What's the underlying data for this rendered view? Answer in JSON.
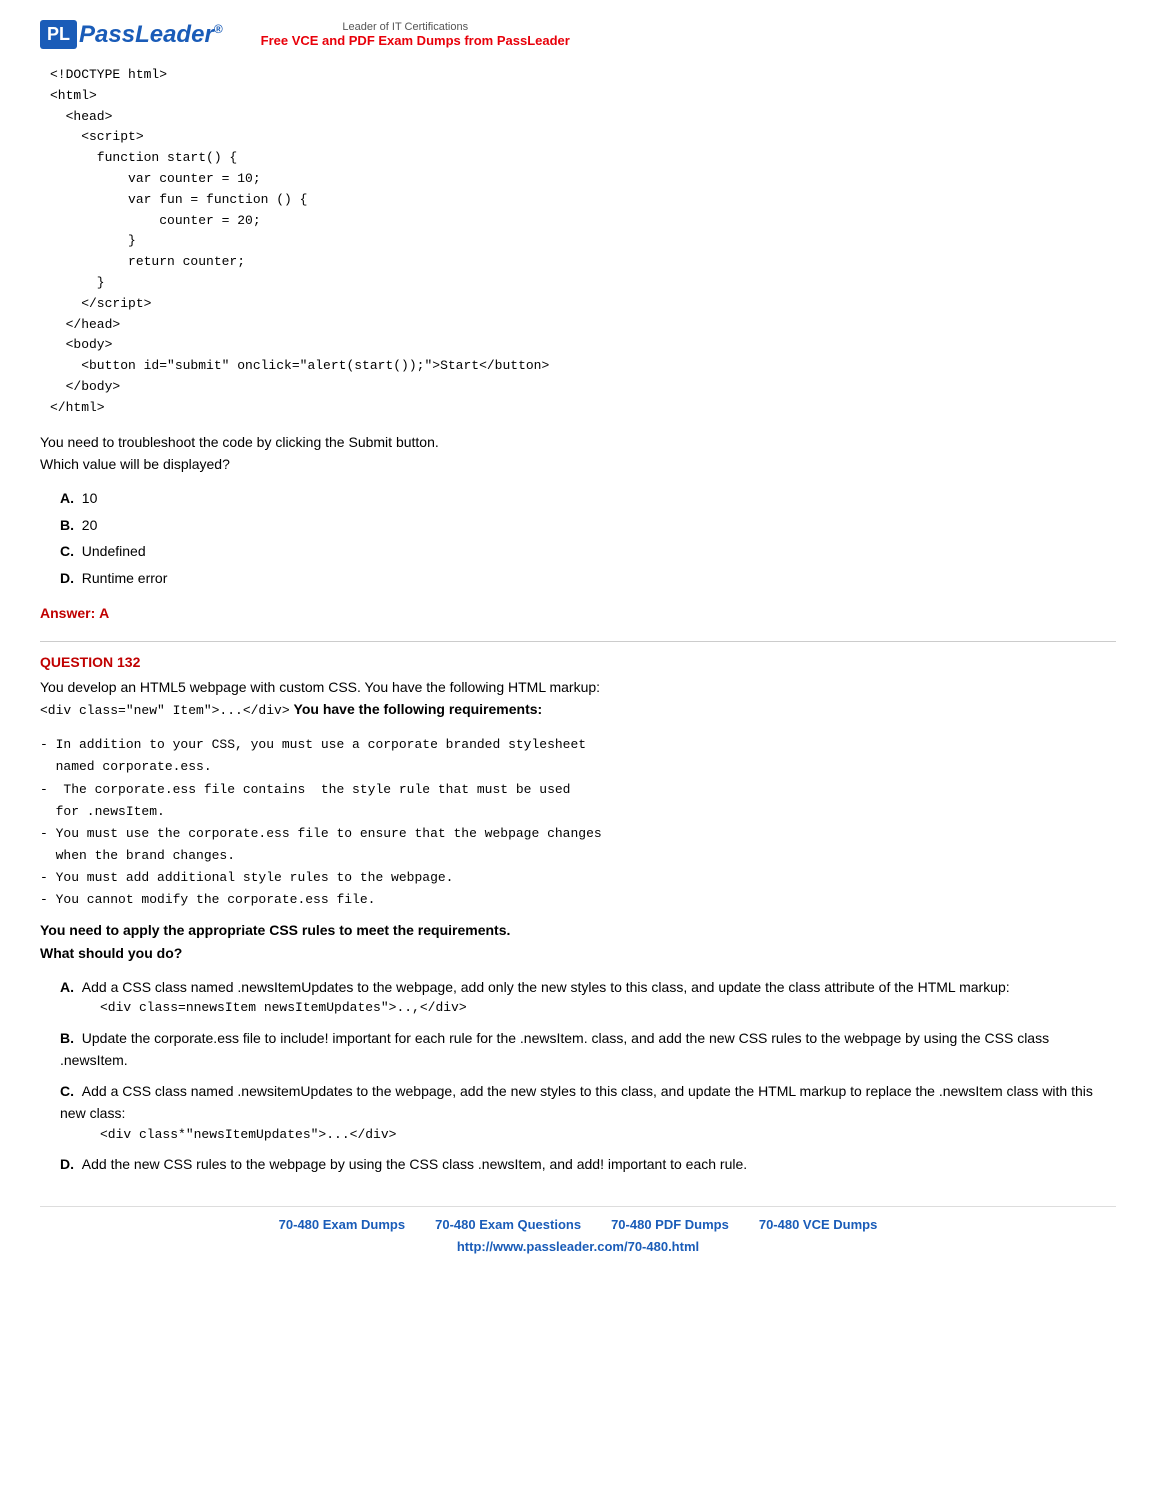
{
  "header": {
    "logo_pl": "PL",
    "logo_name": "Pass",
    "logo_name_italic": "Leader",
    "logo_reg": "®",
    "leader_subtitle": "Leader of IT Certifications",
    "free_vce": "Free VCE and PDF Exam Dumps from PassLeader"
  },
  "code_block": {
    "lines": [
      "<!DOCTYPE html>",
      "<html>",
      "  <head>",
      "    <script>",
      "      function start() {",
      "          var counter = 10;",
      "          var fun = function () {",
      "              counter = 20;",
      "          }",
      "          return counter;",
      "      }",
      "    </script>",
      "  </head>",
      "  <body>",
      "    <button id=\"submit\" onclick=\"alert(start());\">Start</button>",
      "  </body>",
      "</html>"
    ]
  },
  "question_131": {
    "instruction_1": "You need to troubleshoot the code by clicking the Submit button.",
    "instruction_2": "Which value will be displayed?",
    "options": [
      {
        "label": "A.",
        "text": "10"
      },
      {
        "label": "B.",
        "text": "20"
      },
      {
        "label": "C.",
        "text": "Undefined"
      },
      {
        "label": "D.",
        "text": "Runtime error"
      }
    ],
    "answer_label": "Answer:",
    "answer_value": "A"
  },
  "question_132": {
    "header": "QUESTION 132",
    "intro": "You develop an HTML5 webpage with custom CSS. You have the following HTML markup:",
    "markup_example": "<div class=\"new\" Item\">...</div>",
    "requirements_header": "You have the following requirements:",
    "requirements": [
      "- In addition to your CSS, you must use a corporate branded stylesheet",
      "  named corporate.ess.",
      "- The corporate.ess file contains  the style rule that must be used",
      "  for .newsItem.",
      "- You must use the corporate.ess file to ensure that the webpage changes",
      "  when the brand changes.",
      "- You must add additional style rules to the webpage.",
      "- You cannot modify the corporate.ess file."
    ],
    "final_instruction_1": "You need to apply the appropriate CSS rules to meet the requirements.",
    "final_instruction_2": "What should you do?",
    "options": [
      {
        "label": "A.",
        "text": "Add a CSS class named .newsItemUpdates to the webpage, add only the new styles to this class, and update the class attribute of the HTML markup:",
        "sub": "<div class=nnewsItem newsItemUpdates\">..,</div>"
      },
      {
        "label": "B.",
        "text": "Update the corporate.ess file to include! important for each rule for the .newsItem. class, and add the new CSS rules to the webpage by using the CSS class .newsItem."
      },
      {
        "label": "C.",
        "text": "Add a CSS class named .newsitemUpdates to the webpage, add the new styles to this class, and update the HTML markup to replace the .newsItem class with this new class:",
        "sub": "<div class*\"newsItemUpdates\">...</div>"
      },
      {
        "label": "D.",
        "text": "Add the new CSS rules to the webpage by using the CSS class .newsItem, and add! important to each rule."
      }
    ]
  },
  "footer": {
    "links": [
      "70-480 Exam Dumps",
      "70-480 Exam Questions",
      "70-480 PDF Dumps",
      "70-480 VCE Dumps"
    ],
    "url": "http://www.passleader.com/70-480.html"
  }
}
